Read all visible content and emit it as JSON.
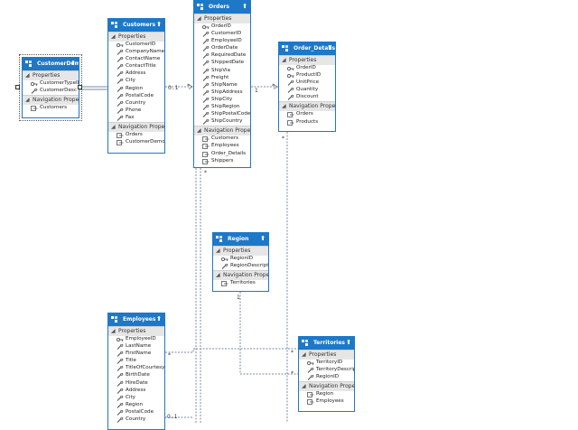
{
  "entities": {
    "customerdemo": {
      "title": "CustomerDem...",
      "icon": "entity-icon",
      "sections": [
        {
          "label": "Properties",
          "rows": [
            {
              "label": "CustomerTypeID",
              "icon": "key-icon"
            },
            {
              "label": "CustomerDesc",
              "icon": "wrench-icon"
            }
          ]
        },
        {
          "label": "Navigation Properties",
          "rows": [
            {
              "label": "Customers",
              "icon": "navigation-property-icon"
            }
          ]
        }
      ]
    },
    "customers": {
      "title": "Customers",
      "icon": "entity-icon",
      "sections": [
        {
          "label": "Properties",
          "rows": [
            {
              "label": "CustomerID",
              "icon": "key-icon"
            },
            {
              "label": "CompanyName",
              "icon": "wrench-icon"
            },
            {
              "label": "ContactName",
              "icon": "wrench-icon"
            },
            {
              "label": "ContactTitle",
              "icon": "wrench-icon"
            },
            {
              "label": "Address",
              "icon": "wrench-icon"
            },
            {
              "label": "City",
              "icon": "wrench-icon"
            },
            {
              "label": "Region",
              "icon": "wrench-icon"
            },
            {
              "label": "PostalCode",
              "icon": "wrench-icon"
            },
            {
              "label": "Country",
              "icon": "wrench-icon"
            },
            {
              "label": "Phone",
              "icon": "wrench-icon"
            },
            {
              "label": "Fax",
              "icon": "wrench-icon"
            }
          ]
        },
        {
          "label": "Navigation Properties",
          "rows": [
            {
              "label": "Orders",
              "icon": "navigation-property-icon"
            },
            {
              "label": "CustomerDemo...",
              "icon": "navigation-property-icon"
            }
          ]
        }
      ]
    },
    "orders": {
      "title": "Orders",
      "icon": "entity-icon",
      "sections": [
        {
          "label": "Properties",
          "rows": [
            {
              "label": "OrderID",
              "icon": "key-icon"
            },
            {
              "label": "CustomerID",
              "icon": "wrench-icon"
            },
            {
              "label": "EmployeeID",
              "icon": "wrench-icon"
            },
            {
              "label": "OrderDate",
              "icon": "wrench-icon"
            },
            {
              "label": "RequiredDate",
              "icon": "wrench-icon"
            },
            {
              "label": "ShippedDate",
              "icon": "wrench-icon"
            },
            {
              "label": "ShipVia",
              "icon": "wrench-icon"
            },
            {
              "label": "Freight",
              "icon": "wrench-icon"
            },
            {
              "label": "ShipName",
              "icon": "wrench-icon"
            },
            {
              "label": "ShipAddress",
              "icon": "wrench-icon"
            },
            {
              "label": "ShipCity",
              "icon": "wrench-icon"
            },
            {
              "label": "ShipRegion",
              "icon": "wrench-icon"
            },
            {
              "label": "ShipPostalCode",
              "icon": "wrench-icon"
            },
            {
              "label": "ShipCountry",
              "icon": "wrench-icon"
            }
          ]
        },
        {
          "label": "Navigation Properties",
          "rows": [
            {
              "label": "Customers",
              "icon": "navigation-property-icon"
            },
            {
              "label": "Employees",
              "icon": "navigation-property-icon"
            },
            {
              "label": "Order_Details",
              "icon": "navigation-property-icon"
            },
            {
              "label": "Shippers",
              "icon": "navigation-property-icon"
            }
          ]
        }
      ]
    },
    "orderdetails": {
      "title": "Order_Details",
      "icon": "entity-icon",
      "sections": [
        {
          "label": "Properties",
          "rows": [
            {
              "label": "OrderID",
              "icon": "key-icon"
            },
            {
              "label": "ProductID",
              "icon": "key-icon"
            },
            {
              "label": "UnitPrice",
              "icon": "wrench-icon"
            },
            {
              "label": "Quantity",
              "icon": "wrench-icon"
            },
            {
              "label": "Discount",
              "icon": "wrench-icon"
            }
          ]
        },
        {
          "label": "Navigation Properties",
          "rows": [
            {
              "label": "Orders",
              "icon": "navigation-property-icon"
            },
            {
              "label": "Products",
              "icon": "navigation-property-icon"
            }
          ]
        }
      ]
    },
    "region": {
      "title": "Region",
      "icon": "entity-icon",
      "sections": [
        {
          "label": "Properties",
          "rows": [
            {
              "label": "RegionID",
              "icon": "key-icon"
            },
            {
              "label": "RegionDescript...",
              "icon": "wrench-icon"
            }
          ]
        },
        {
          "label": "Navigation Properties",
          "rows": [
            {
              "label": "Territories",
              "icon": "navigation-property-icon"
            }
          ]
        }
      ]
    },
    "employees": {
      "title": "Employees",
      "icon": "entity-icon",
      "sections": [
        {
          "label": "Properties",
          "rows": [
            {
              "label": "EmployeeID",
              "icon": "key-icon"
            },
            {
              "label": "LastName",
              "icon": "wrench-icon"
            },
            {
              "label": "FirstName",
              "icon": "wrench-icon"
            },
            {
              "label": "Title",
              "icon": "wrench-icon"
            },
            {
              "label": "TitleOfCourtesy",
              "icon": "wrench-icon"
            },
            {
              "label": "BirthDate",
              "icon": "wrench-icon"
            },
            {
              "label": "HireDate",
              "icon": "wrench-icon"
            },
            {
              "label": "Address",
              "icon": "wrench-icon"
            },
            {
              "label": "City",
              "icon": "wrench-icon"
            },
            {
              "label": "Region",
              "icon": "wrench-icon"
            },
            {
              "label": "PostalCode",
              "icon": "wrench-icon"
            },
            {
              "label": "Country",
              "icon": "wrench-icon"
            }
          ]
        }
      ]
    },
    "territories": {
      "title": "Territories",
      "icon": "entity-icon",
      "sections": [
        {
          "label": "Properties",
          "rows": [
            {
              "label": "TerritoryID",
              "icon": "key-icon"
            },
            {
              "label": "TerritoryDescript...",
              "icon": "wrench-icon"
            },
            {
              "label": "RegionID",
              "icon": "wrench-icon"
            }
          ]
        },
        {
          "label": "Navigation Properties",
          "rows": [
            {
              "label": "Region",
              "icon": "navigation-property-icon"
            },
            {
              "label": "Employees",
              "icon": "navigation-property-icon"
            }
          ]
        }
      ]
    }
  },
  "multiplicities": {
    "customers_orders_one": "0..1",
    "customers_orders_many": "*",
    "orders_details_one": "1",
    "orders_details_many": "*",
    "orders_customers_many": "*",
    "orders_employees_many": "*",
    "employees_territories_many_left": "*",
    "employees_territories_many_right": "*",
    "employees_orders_one": "0..1",
    "region_territories_one": "1",
    "region_territories_many": "*"
  },
  "colors": {
    "entity_header": "#1e78c8",
    "section_header": "#e6e6e6",
    "connector": "#7a8aa0"
  }
}
